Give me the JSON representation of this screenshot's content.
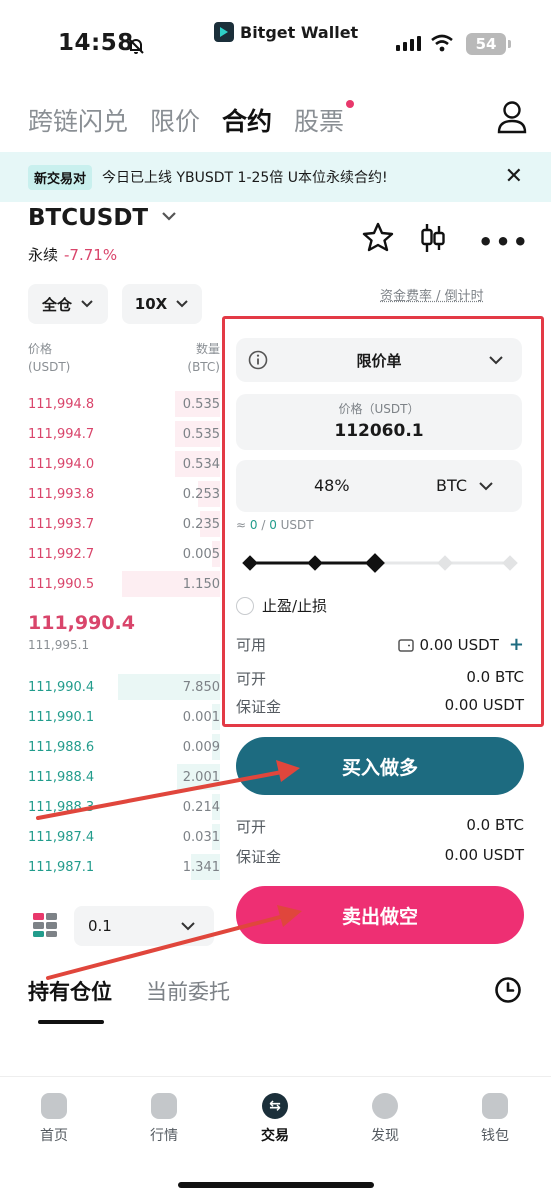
{
  "status_bar": {
    "time": "14:58",
    "brand": "Bitget Wallet",
    "battery": "54"
  },
  "tabs": [
    {
      "label": "跨链闪兑"
    },
    {
      "label": "限价"
    },
    {
      "label": "合约"
    },
    {
      "label": "股票"
    }
  ],
  "banner": {
    "badge": "新交易对",
    "text": "今日已上线 YBUSDT 1-25倍 U本位永续合约!"
  },
  "pair": {
    "symbol": "BTCUSDT",
    "type": "永续",
    "change": "-7.71%"
  },
  "margin_mode": "全仓",
  "leverage": "10X",
  "funding": {
    "label": "资金费率 / 倒计时"
  },
  "orderbook": {
    "price_header": "价格",
    "price_unit": "(USDT)",
    "qty_header": "数量",
    "qty_unit": "(BTC)",
    "asks": [
      {
        "price": "111,994.8",
        "qty": "0.535"
      },
      {
        "price": "111,994.7",
        "qty": "0.535"
      },
      {
        "price": "111,994.0",
        "qty": "0.534"
      },
      {
        "price": "111,993.8",
        "qty": "0.253"
      },
      {
        "price": "111,993.7",
        "qty": "0.235"
      },
      {
        "price": "111,992.7",
        "qty": "0.005"
      },
      {
        "price": "111,990.5",
        "qty": "1.150"
      }
    ],
    "last_price": "111,990.4",
    "mark_price": "111,995.1",
    "bids": [
      {
        "price": "111,990.4",
        "qty": "7.850"
      },
      {
        "price": "111,990.1",
        "qty": "0.001"
      },
      {
        "price": "111,988.6",
        "qty": "0.009"
      },
      {
        "price": "111,988.4",
        "qty": "2.001"
      },
      {
        "price": "111,988.3",
        "qty": "0.214"
      },
      {
        "price": "111,987.4",
        "qty": "0.031"
      },
      {
        "price": "111,987.1",
        "qty": "1.341"
      }
    ],
    "depth": "0.1"
  },
  "order": {
    "type": "限价单",
    "price_label": "价格（USDT）",
    "price_value": "112060.1",
    "amount_percent": "48%",
    "amount_unit": "BTC",
    "approx_prefix": "≈ ",
    "approx_a": "0",
    "approx_sep": " / ",
    "approx_b": "0",
    "approx_unit": " USDT",
    "slider_level": 0.5,
    "tpsl_label": "止盈/止损",
    "available_label": "可用",
    "available_value": "0.00 USDT",
    "long_open_label": "可开",
    "long_open_value": "0.0 BTC",
    "long_margin_label": "保证金",
    "long_margin_value": "0.00 USDT",
    "buy_label": "买入做多",
    "short_open_label": "可开",
    "short_open_value": "0.0 BTC",
    "short_margin_label": "保证金",
    "short_margin_value": "0.00 USDT",
    "sell_label": "卖出做空"
  },
  "positions": {
    "tab_holdings": "持有仓位",
    "tab_orders": "当前委托"
  },
  "bottom_nav": [
    {
      "label": "首页"
    },
    {
      "label": "行情"
    },
    {
      "label": "交易"
    },
    {
      "label": "发现"
    },
    {
      "label": "钱包"
    }
  ],
  "colors": {
    "ask": "#d9456b",
    "bid": "#229c8c",
    "long": "#1d6b80",
    "short": "#ee2f73",
    "highlight": "#e33a46"
  }
}
